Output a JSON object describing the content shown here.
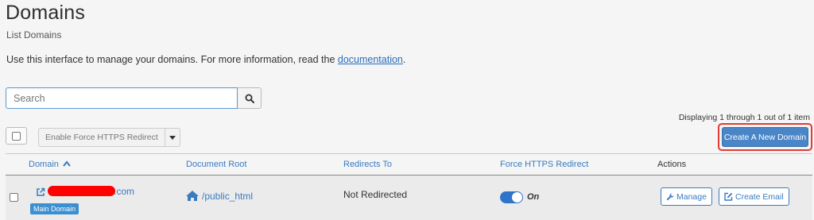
{
  "page": {
    "title": "Domains",
    "subtitle": "List Domains",
    "intro_text": "Use this interface to manage your domains. For more information, read the ",
    "intro_link": "documentation",
    "intro_end": "."
  },
  "search": {
    "placeholder": "Search"
  },
  "paging": {
    "text": "Displaying 1 through 1 out of 1 item"
  },
  "toolbar": {
    "https_redirect_label": "Enable Force HTTPS Redirect",
    "create_label": "Create A New Domain"
  },
  "table": {
    "columns": {
      "domain": "Domain",
      "document_root": "Document Root",
      "redirects_to": "Redirects To",
      "force_https": "Force HTTPS Redirect",
      "actions": "Actions"
    },
    "rows": [
      {
        "domain_suffix": ".com",
        "badge": "Main Domain",
        "document_root": "/public_html",
        "redirects_to": "Not Redirected",
        "force_https_state": "On",
        "manage_label": "Manage",
        "create_email_label": "Create Email"
      }
    ]
  },
  "colors": {
    "accent": "#3a7bc0",
    "primary_button": "#4a85c7",
    "highlight": "#e53935",
    "redaction": "#ff0000",
    "toggle_on": "#2f74c9"
  },
  "icons": [
    "search-icon",
    "caret-down-icon",
    "sort-ascending-icon",
    "external-link-icon",
    "home-icon",
    "wrench-icon",
    "edit-icon"
  ]
}
